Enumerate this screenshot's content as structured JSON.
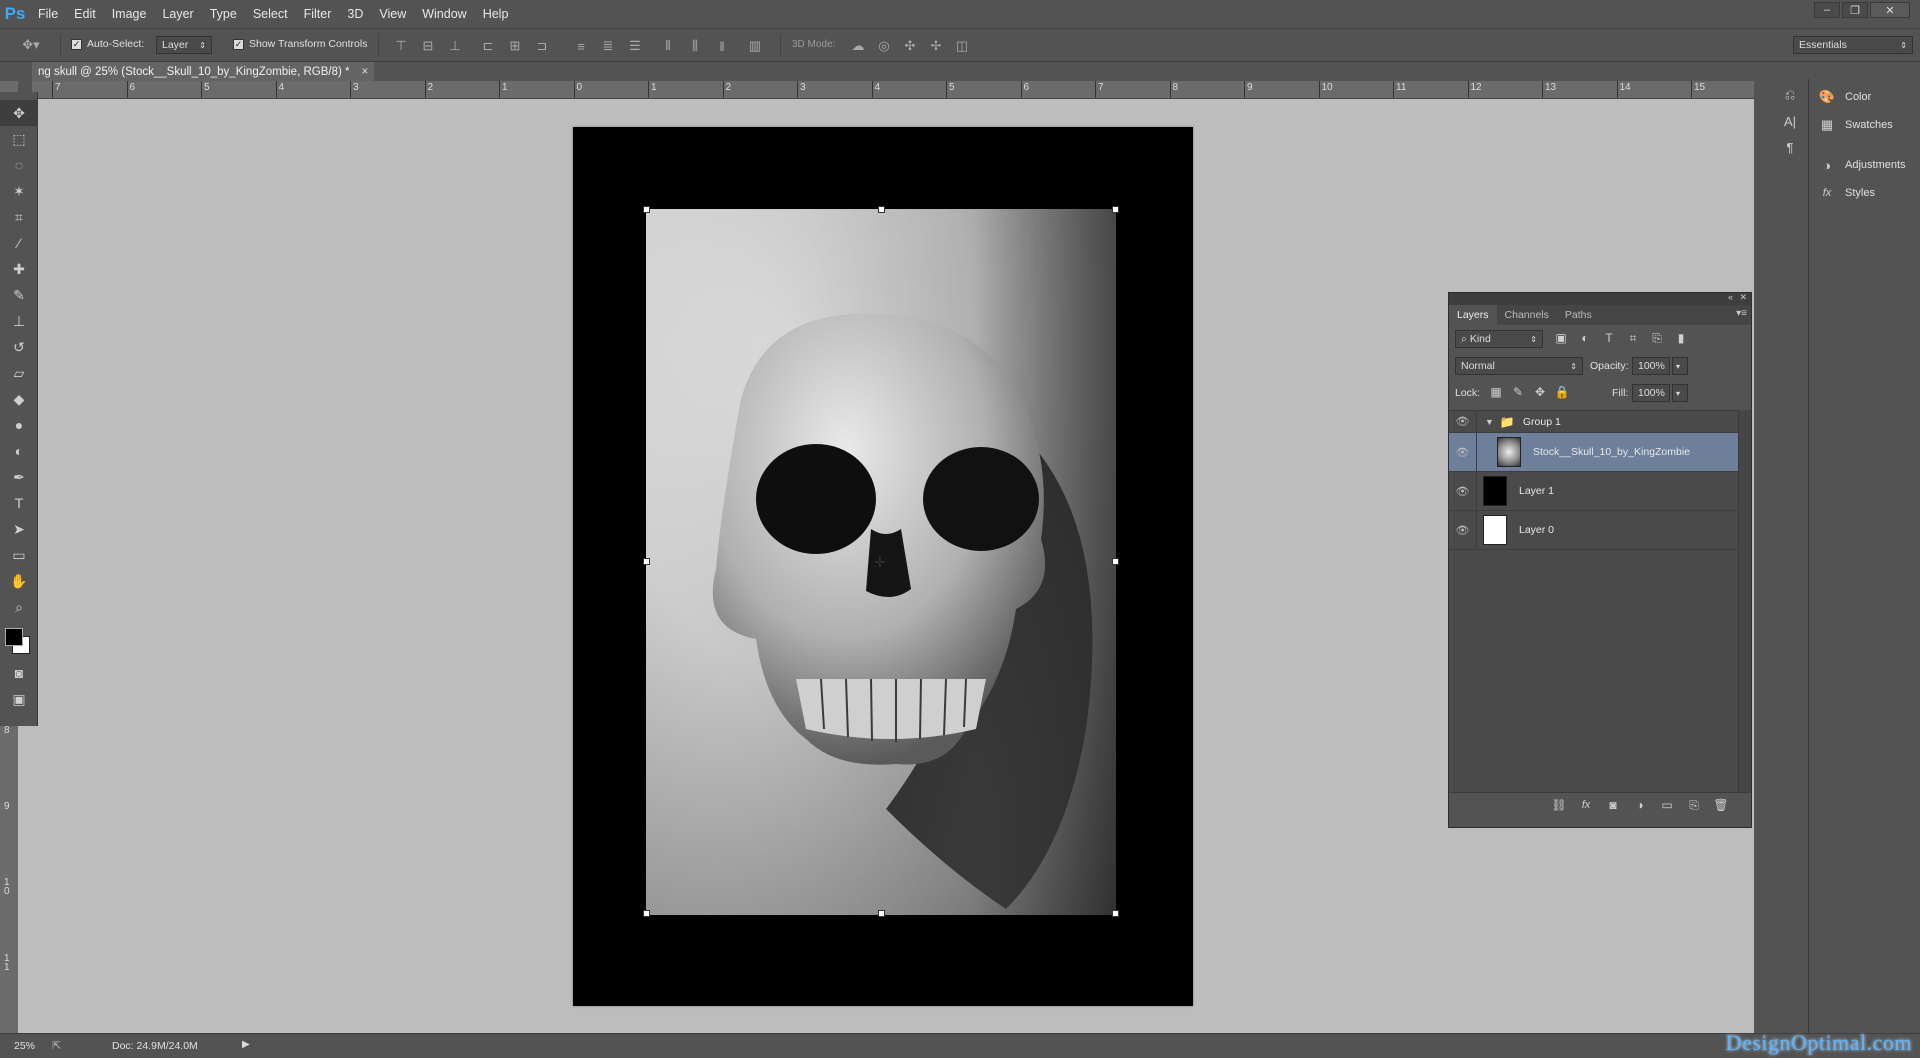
{
  "app": {
    "logo": "Ps"
  },
  "menu": [
    "File",
    "Edit",
    "Image",
    "Layer",
    "Type",
    "Select",
    "Filter",
    "3D",
    "View",
    "Window",
    "Help"
  ],
  "window_controls": {
    "minimize": "–",
    "restore": "❐",
    "close": "✕"
  },
  "options_bar": {
    "auto_select_label": "Auto-Select:",
    "auto_select_target": "Layer",
    "show_transform_label": "Show Transform Controls",
    "mode_3d_label": "3D Mode:",
    "workspace": "Essentials"
  },
  "document_tab": {
    "title": "ng skull @ 25% (Stock__Skull_10_by_KingZombie, RGB/8) *",
    "close": "×"
  },
  "hruler_labels": [
    "7",
    "6",
    "5",
    "4",
    "3",
    "2",
    "1",
    "0",
    "1",
    "2",
    "3",
    "4",
    "5",
    "6",
    "7",
    "8",
    "9",
    "10",
    "11",
    "12",
    "13",
    "14",
    "15"
  ],
  "vruler_labels": [
    "8",
    "9",
    "1 0",
    "1 1"
  ],
  "right_dock": {
    "items": [
      {
        "label": "Color",
        "icon": "color-palette-icon"
      },
      {
        "label": "Swatches",
        "icon": "swatches-grid-icon"
      },
      {
        "label": "Adjustments",
        "icon": "adjustments-circle-icon"
      },
      {
        "label": "Styles",
        "icon": "fx-styles-icon"
      }
    ]
  },
  "layers_panel": {
    "tabs": [
      "Layers",
      "Channels",
      "Paths"
    ],
    "filter_kind": "Kind",
    "blend_mode": "Normal",
    "opacity_label": "Opacity:",
    "opacity_value": "100%",
    "lock_label": "Lock:",
    "fill_label": "Fill:",
    "fill_value": "100%",
    "layers": [
      {
        "name": "Group 1",
        "type": "group"
      },
      {
        "name": "Stock__Skull_10_by_KingZombie",
        "type": "smart",
        "selected": true
      },
      {
        "name": "Layer 1",
        "type": "fill-black"
      },
      {
        "name": "Layer 0",
        "type": "fill-white"
      }
    ]
  },
  "status_bar": {
    "zoom": "25%",
    "doc_size": "Doc: 24.9M/24.0M"
  },
  "watermark": "DesignOptimal.com",
  "colors": {
    "selection": "#6d7f99",
    "ps_blue": "#3fa9f5",
    "canvas_bg": "#bdbdbd"
  }
}
